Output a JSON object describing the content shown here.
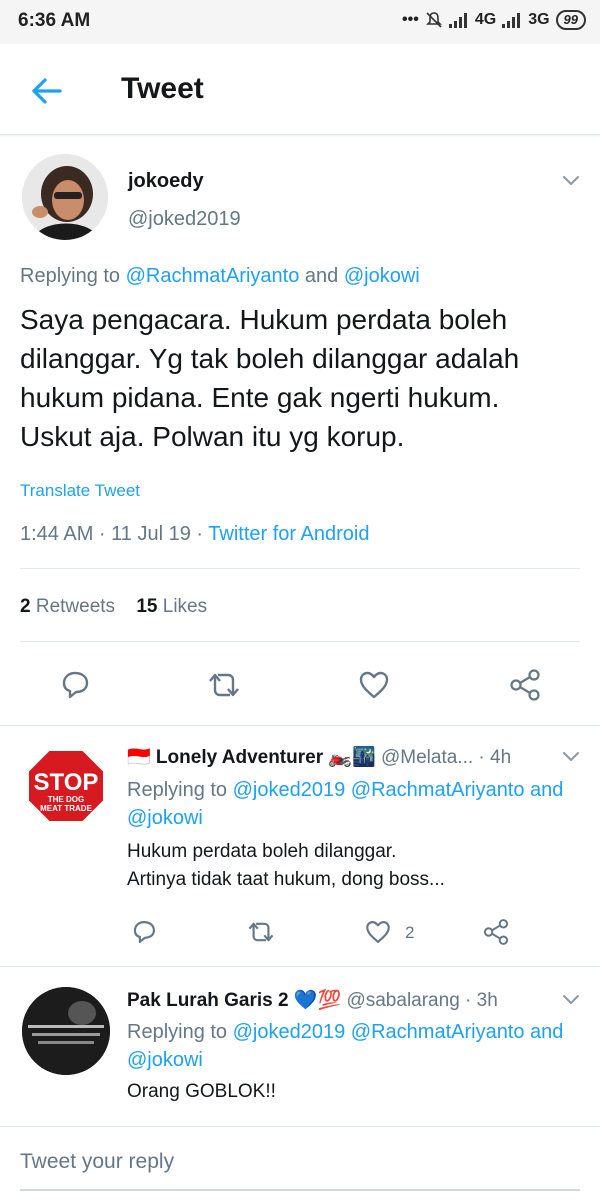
{
  "status_bar": {
    "time": "6:36 AM",
    "network1": "4G",
    "network2": "3G",
    "battery": "99"
  },
  "header": {
    "title": "Tweet"
  },
  "main_tweet": {
    "name": "jokoedy",
    "handle": "@joked2019",
    "replying_prefix": "Replying to",
    "replying_user1": "@RachmatAriyanto",
    "replying_and": "and",
    "replying_user2": "@jokowi",
    "text_line1": "Saya pengacara. Hukum perdata boleh",
    "text_line2": "dilanggar. Yg tak boleh dilanggar adalah",
    "text_line3": "hukum pidana. Ente gak ngerti hukum.",
    "text_line4": "Uskut aja. Polwan itu yg korup.",
    "translate": "Translate Tweet",
    "timestamp": "1:44 AM · 11 Jul 19 · ",
    "source": "Twitter for Android",
    "retweets_count": "2",
    "retweets_label": "Retweets",
    "likes_count": "15",
    "likes_label": "Likes"
  },
  "replies": [
    {
      "name": "🇮🇩 Lonely Adventurer 🏍️🌃",
      "handle": "@Melata...",
      "time": "· 4h",
      "replying_prefix": "Replying to",
      "replying_line1_users": "@joked2019 @RachmatAriyanto and",
      "replying_line2_users": "@jokowi",
      "text_line1": "Hukum perdata boleh dilanggar.",
      "text_line2": "Artinya tidak taat hukum, dong boss...",
      "like_count": "2",
      "avatar_line1": "STOP",
      "avatar_line2": "THE DOG",
      "avatar_line3": "MEAT TRADE"
    },
    {
      "name": "Pak Lurah Garis 2 💙💯",
      "handle": "@sabalarang",
      "time": "· 3h",
      "replying_prefix": "Replying to",
      "replying_line1_users": "@joked2019 @RachmatAriyanto and",
      "replying_line2_users": "@jokowi",
      "text_line1": "Orang GOBLOK!!"
    }
  ],
  "reply_box": {
    "placeholder": "Tweet your reply"
  },
  "colors": {
    "accent": "#1da1f2",
    "secondary_text": "#657786",
    "divider": "#e1e8ed"
  }
}
